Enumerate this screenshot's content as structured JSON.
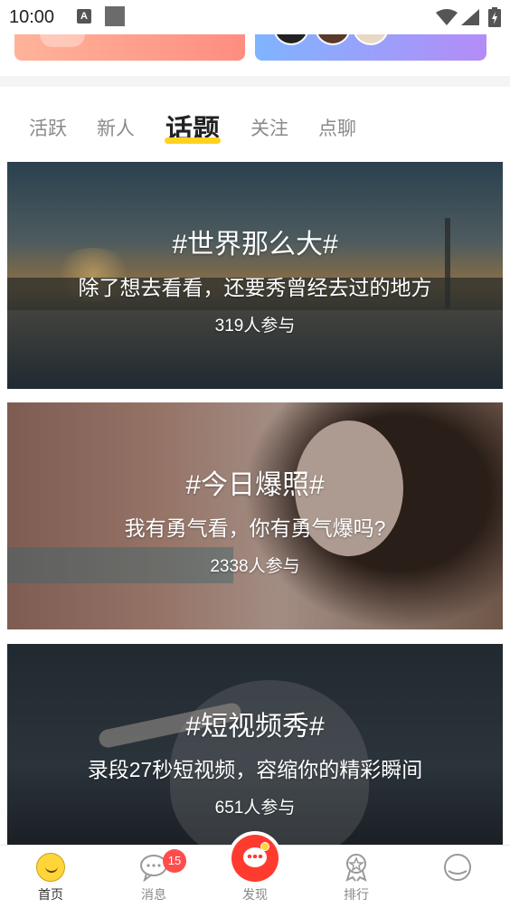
{
  "status_bar": {
    "time": "10:00",
    "notification_icon": "A"
  },
  "tabs": [
    {
      "label": "活跃",
      "active": false
    },
    {
      "label": "新人",
      "active": false
    },
    {
      "label": "话题",
      "active": true
    },
    {
      "label": "关注",
      "active": false
    },
    {
      "label": "点聊",
      "active": false
    }
  ],
  "topics": [
    {
      "title": "#世界那么大#",
      "subtitle": "除了想去看看，还要秀曾经去过的地方",
      "count": "319人参与"
    },
    {
      "title": "#今日爆照#",
      "subtitle": "我有勇气看，你有勇气爆吗?",
      "count": "2338人参与"
    },
    {
      "title": "#短视频秀#",
      "subtitle": "录段27秒短视频，容缩你的精彩瞬间",
      "count": "651人参与"
    }
  ],
  "bottom_nav": {
    "home": {
      "label": "首页",
      "icon": "smiley-icon"
    },
    "messages": {
      "label": "消息",
      "icon": "chat-icon",
      "badge": "15"
    },
    "discover": {
      "label": "发现",
      "icon": "discover-chat-icon"
    },
    "ranking": {
      "label": "排行",
      "icon": "medal-icon"
    },
    "profile": {
      "label": "",
      "icon": "profile-icon"
    }
  },
  "colors": {
    "accent_yellow": "#ffd21f",
    "discover_red": "#ff3b2f",
    "badge_red": "#ff4d4d"
  }
}
